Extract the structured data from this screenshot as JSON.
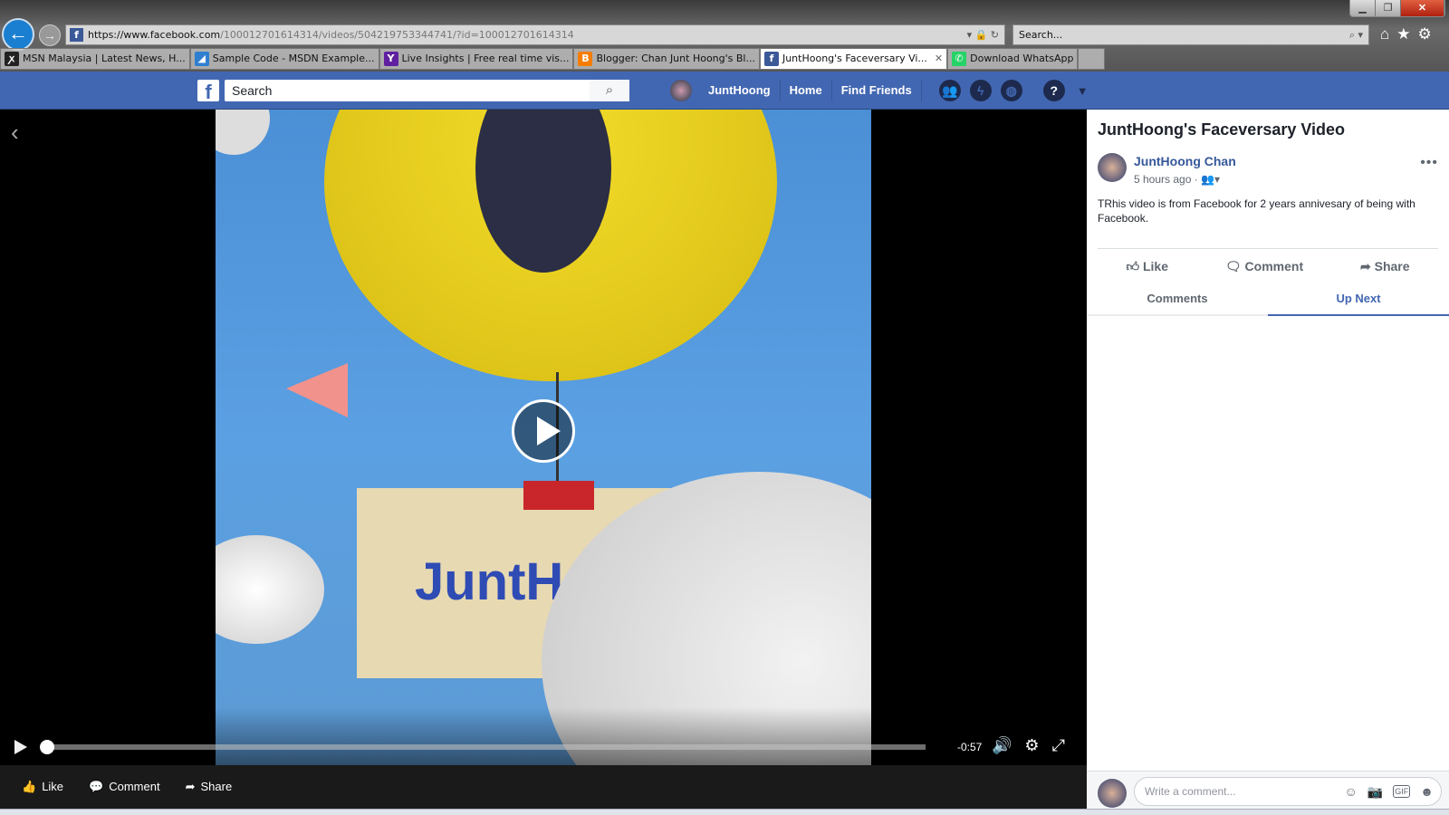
{
  "browser": {
    "url_prefix": "https://www.",
    "url_domain": "facebook.com",
    "url_path": "/100012701614314/videos/504219753344741/?id=100012701614314",
    "search_placeholder": "Search...",
    "tabs": [
      {
        "label": "MSN Malaysia | Latest News, H...",
        "icon": "msn-icon",
        "color": "#222"
      },
      {
        "label": "Sample Code - MSDN Example...",
        "icon": "msdn-icon",
        "color": "#2f7fd0"
      },
      {
        "label": "Live Insights | Free real time vis...",
        "icon": "yahoo-icon",
        "color": "#5f1fa0"
      },
      {
        "label": "Blogger: Chan Junt Hoong's Bl...",
        "icon": "blogger-icon",
        "color": "#f57d00"
      },
      {
        "label": "JuntHoong's Faceversary Vi...",
        "icon": "facebook-icon",
        "color": "#3b5998",
        "active": true
      },
      {
        "label": "Download WhatsApp",
        "icon": "whatsapp-icon",
        "color": "#25d366"
      }
    ]
  },
  "fb": {
    "brand_color": "#4267b2",
    "search_placeholder": "Search",
    "user": "JuntHoong",
    "nav": [
      "Home",
      "Find Friends"
    ]
  },
  "video": {
    "sign_text": "JuntHoong",
    "time_remaining": "-0:57",
    "progress": 0
  },
  "video_actions": [
    "Like",
    "Comment",
    "Share"
  ],
  "panel": {
    "title": "JuntHoong's Faceversary Video",
    "author": "JuntHoong Chan",
    "time": "5 hours ago",
    "separator": "·",
    "description": "TRhis video is from Facebook for 2 years annivesary of being with Facebook.",
    "actions": [
      "Like",
      "Comment",
      "Share"
    ],
    "tabs": [
      "Comments",
      "Up Next"
    ],
    "active_tab": "Up Next",
    "comment_placeholder": "Write a comment..."
  }
}
